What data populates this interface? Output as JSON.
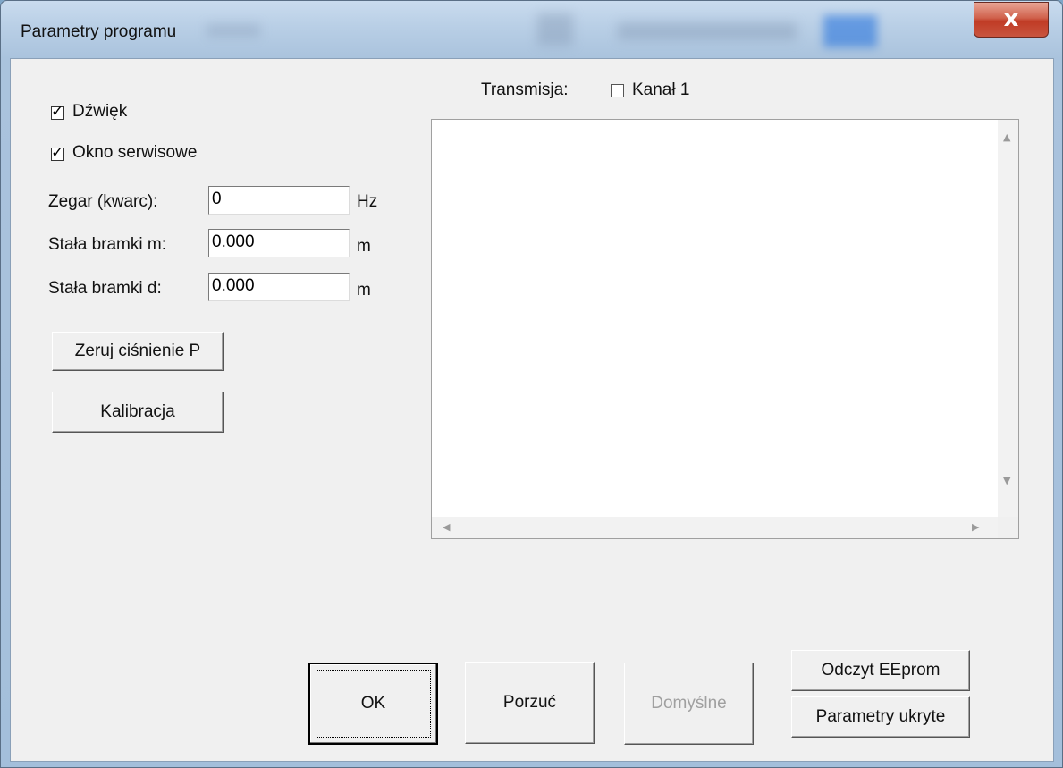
{
  "window": {
    "title": "Parametry programu",
    "close_glyph": "x"
  },
  "left": {
    "checkboxes": [
      {
        "label": "Dźwięk",
        "checked": true
      },
      {
        "label": "Okno serwisowe",
        "checked": true
      }
    ],
    "fields": [
      {
        "label": "Zegar (kwarc):",
        "value": "0",
        "unit": "Hz"
      },
      {
        "label": "Stała bramki m:",
        "value": "0.000",
        "unit": "m"
      },
      {
        "label": "Stała bramki d:",
        "value": "0.000",
        "unit": "m"
      }
    ],
    "buttons": {
      "zero": "Zeruj ciśnienie P",
      "calibrate": "Kalibracja"
    }
  },
  "transmission": {
    "label": "Transmisja:",
    "channel_label": "Kanał 1",
    "channel_checked": false
  },
  "log": {
    "content": ""
  },
  "footer": {
    "ok": "OK",
    "cancel": "Porzuć",
    "defaults": "Domyślne",
    "read_eeprom": "Odczyt EEprom",
    "hidden_params": "Parametry ukryte"
  },
  "icons": {
    "check": "checkmark-icon",
    "close": "close-icon",
    "scroll": "arrow-icons"
  }
}
